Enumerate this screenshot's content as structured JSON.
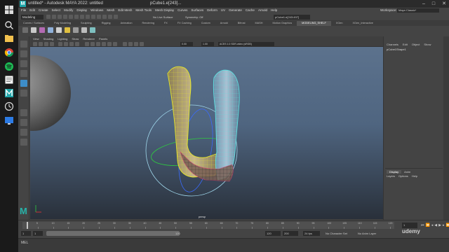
{
  "titlebar": {
    "title": "untitled* - Autodesk MAYA 2022: untitled",
    "tab": "pCube1.e[243]...",
    "logo": "M",
    "controls": [
      "–",
      "□",
      "✕"
    ]
  },
  "menubar": {
    "items": [
      "File",
      "Edit",
      "Create",
      "Select",
      "Modify",
      "Display",
      "Windows",
      "Mesh",
      "Edit Mesh",
      "Mesh Tools",
      "Mesh Display",
      "Curves",
      "Surfaces",
      "Deform",
      "UV",
      "Generate",
      "Cache",
      "Arnold",
      "Help"
    ],
    "workspace_label": "Workspace:",
    "workspace_value": "Maya Classic*"
  },
  "statusline": {
    "mode": "Modeling",
    "live_surface": "No Live Surface",
    "symmetry": "Symmetry: Off",
    "selection_field": "pCube1.e[243:497]"
  },
  "shelf": {
    "tabs": [
      "Curves / Surfaces",
      "Poly Modeling",
      "Sculpting",
      "Rigging",
      "Animation",
      "Rendering",
      "FX",
      "FX Caching",
      "Custom",
      "Arnold",
      "Bifrost",
      "MASH",
      "Motion Graphics",
      "MODELING_SHELF",
      "XGen",
      "XGen_Interactive"
    ],
    "active_tab": "MODELING_SHELF"
  },
  "viewport": {
    "menu": [
      "View",
      "Shading",
      "Lighting",
      "Show",
      "Renderer",
      "Panels"
    ],
    "field_a": "0.00",
    "field_b": "1.00",
    "color_space": "ACES 1.0 SDR-video (sRGB)",
    "camera_label": "persp"
  },
  "channel_box": {
    "tabs": [
      "Channels",
      "Edit",
      "Object",
      "Show"
    ],
    "node_name": "pCube1Shape1"
  },
  "layer_editor": {
    "tabs": [
      "Display",
      "Anim"
    ],
    "active_tab": "Display",
    "menu": [
      "Layers",
      "Options",
      "Help"
    ]
  },
  "timeslider": {
    "ticks": [
      "5",
      "10",
      "15",
      "20",
      "25",
      "30",
      "35",
      "40",
      "45",
      "50",
      "55",
      "60",
      "65",
      "70",
      "75",
      "80",
      "85",
      "90",
      "95",
      "100",
      "105",
      "110",
      "115",
      "120"
    ],
    "current_frame": "1"
  },
  "rangeslider": {
    "start": "1",
    "playback_start": "1",
    "range_label": "120",
    "playback_end": "120",
    "end": "200",
    "fps": "24 fps",
    "character_set": "No Character Set",
    "anim_layer": "No Anim Layer"
  },
  "cmdline": {
    "language": "MEL"
  },
  "watermark": "udemy",
  "colors": {
    "accent_teal": "#1fa4a8",
    "selection_yellow": "#e6e62a",
    "active_cyan": "#5fdfe0"
  }
}
